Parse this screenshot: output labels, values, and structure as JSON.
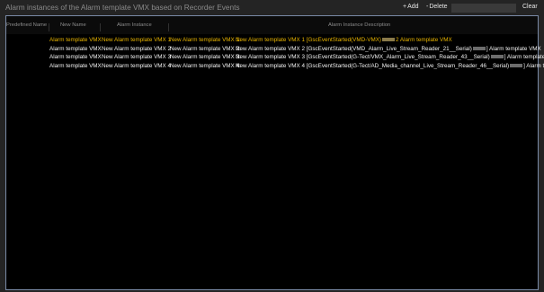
{
  "window": {
    "title": "Alarm instances of the Alarm template VMX based on Recorder Events"
  },
  "toolbar": {
    "add_label": "Add",
    "delete_label": "Delete",
    "search_placeholder": "",
    "clear_label": "Clear"
  },
  "icons": {
    "add": "plus-icon",
    "delete": "minus-icon"
  },
  "table": {
    "headers": {
      "predefined_name": "Predefined Name",
      "new_name": "New Name",
      "alarm_instance": "Alarm Instance",
      "alarm_instance_description": "Alarm Instance Description"
    },
    "rows": [
      {
        "selected": true,
        "predefined_name": "Alarm template VMX",
        "new_name": "New Alarm template VMX 1",
        "alarm_instance": "New Alarm template VMX 1:",
        "description_before": "New Alarm template VMX 1 [GscEventStarted(VMD-VMX)",
        "description_after": "2 Alarm template VMX"
      },
      {
        "selected": false,
        "predefined_name": "Alarm template VMX",
        "new_name": "New Alarm template VMX 2",
        "alarm_instance": "New Alarm template VMX 2:",
        "description_before": "New Alarm template VMX 2 [GscEventStarted(VMD_Alarm_Live_Stream_Reader_21__Serial)",
        "description_after": "] Alarm template VMX"
      },
      {
        "selected": false,
        "predefined_name": "Alarm template VMX",
        "new_name": "New Alarm template VMX 3",
        "alarm_instance": "New Alarm template VMX 3:",
        "description_before": "New Alarm template VMX 3 [GscEventStarted(G-Tect/VMX_Alarm_Live_Stream_Reader_43__Serial)",
        "description_after": "] Alarm template VMX"
      },
      {
        "selected": false,
        "predefined_name": "Alarm template VMX",
        "new_name": "New Alarm template VMX 4",
        "alarm_instance": "New Alarm template VMX 4:",
        "description_before": "New Alarm template VMX 4 [GscEventStarted(G-Tect/AD_Media_channel_Live_Stream_Reader_46__Serial)",
        "description_after": "] Alarm template VMX"
      }
    ]
  },
  "colors": {
    "background": "#242424",
    "panel": "#000000",
    "selected_text": "#e8b400",
    "text": "#f2f2f2",
    "header_text": "#8c8c8c",
    "panel_border": "#7a8aa6"
  }
}
